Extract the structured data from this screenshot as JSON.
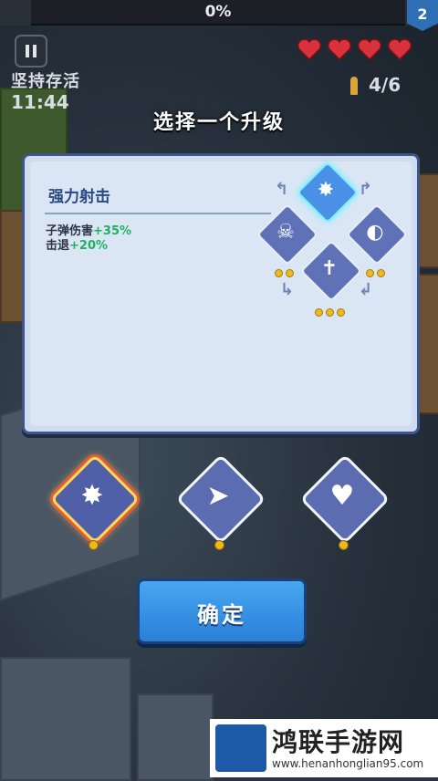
{
  "hud": {
    "progress_text": "0%",
    "level": "2",
    "mode_label": "坚持存活",
    "timer": "11:44",
    "hearts": 4,
    "ammo": "4/6"
  },
  "dialog": {
    "title": "选择一个升级",
    "skill_name": "强力射击",
    "stats": [
      {
        "label": "子弹伤害",
        "value": "+35%"
      },
      {
        "label": "击退",
        "value": "+20%"
      }
    ],
    "confirm_label": "确定"
  },
  "skill_tree": {
    "nodes": [
      {
        "icon": "burst-shot-icon",
        "dots": 0,
        "active": true
      },
      {
        "icon": "skull-explosion-icon",
        "dots": 2,
        "active": false
      },
      {
        "icon": "orbit-shield-icon",
        "dots": 2,
        "active": false
      },
      {
        "icon": "cross-character-icon",
        "dots": 3,
        "active": false
      }
    ]
  },
  "choices": [
    {
      "icon": "burst-shot-icon",
      "selected": true
    },
    {
      "icon": "dash-boot-icon",
      "selected": false
    },
    {
      "icon": "heart-up-icon",
      "selected": false
    }
  ],
  "colors": {
    "accent_blue": "#2a7fd6",
    "stat_green": "#1fb25d",
    "heart_red": "#d8323c",
    "dot_gold": "#f0b81c"
  },
  "watermark": {
    "name": "鸿联手游网",
    "url": "www.henanhonglian95.com"
  }
}
